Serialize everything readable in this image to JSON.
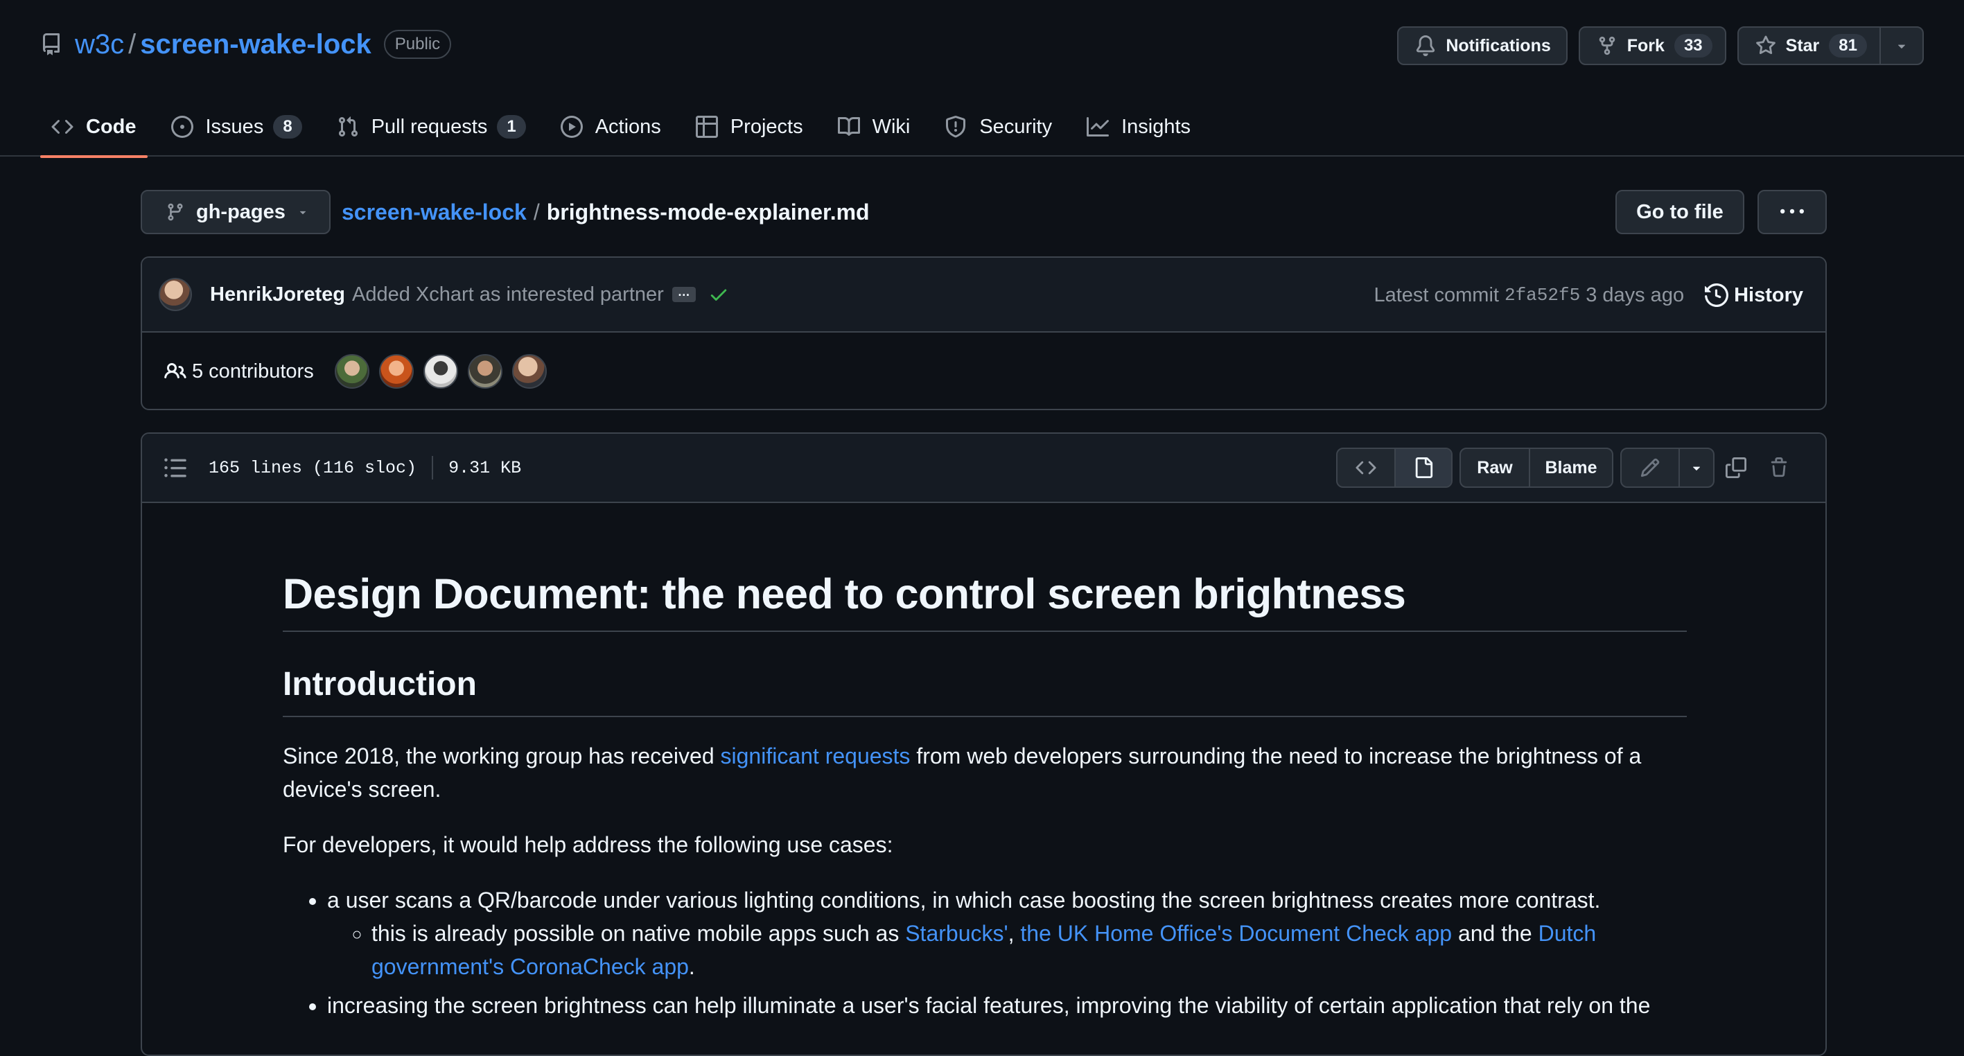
{
  "repo": {
    "owner": "w3c",
    "separator": "/",
    "name": "screen-wake-lock",
    "visibility": "Public"
  },
  "header_actions": {
    "notifications_label": "Notifications",
    "fork_label": "Fork",
    "fork_count": "33",
    "star_label": "Star",
    "star_count": "81"
  },
  "tabs": [
    {
      "label": "Code",
      "icon": "code-icon",
      "selected": true
    },
    {
      "label": "Issues",
      "icon": "issue-icon",
      "count": "8"
    },
    {
      "label": "Pull requests",
      "icon": "pull-request-icon",
      "count": "1"
    },
    {
      "label": "Actions",
      "icon": "play-icon"
    },
    {
      "label": "Projects",
      "icon": "table-icon"
    },
    {
      "label": "Wiki",
      "icon": "book-icon"
    },
    {
      "label": "Security",
      "icon": "shield-icon"
    },
    {
      "label": "Insights",
      "icon": "graph-icon"
    }
  ],
  "breadcrumb": {
    "branch": "gh-pages",
    "repo": "screen-wake-lock",
    "separator": "/",
    "file": "brightness-mode-explainer.md",
    "go_to_file": "Go to file"
  },
  "commit": {
    "author": "HenrikJoreteg",
    "message": "Added Xchart as interested partner",
    "ellipsis": "…",
    "latest_label": "Latest commit",
    "sha": "2fa52f5",
    "age": "3 days ago",
    "history_label": "History",
    "contributors_label": "5 contributors",
    "contributor_avatars": 5
  },
  "file": {
    "lines": "165 lines (116 sloc)",
    "size": "9.31 KB",
    "raw_label": "Raw",
    "blame_label": "Blame"
  },
  "content": {
    "h1": "Design Document: the need to control screen brightness",
    "h2": "Introduction",
    "p1_before": "Since 2018, the working group has received ",
    "p1_link": "significant requests",
    "p1_after": " from web developers surrounding the need to increase the brightness of a device's screen.",
    "p2": "For developers, it would help address the following use cases:",
    "li1": "a user scans a QR/barcode under various lighting conditions, in which case boosting the screen brightness creates more contrast.",
    "li1_sub_before": "this is already possible on native mobile apps such as ",
    "li1_sub_link1": "Starbucks'",
    "li1_sub_comma": ", ",
    "li1_sub_link2": "the UK Home Office's Document Check app",
    "li1_sub_mid": " and the ",
    "li1_sub_link3": "Dutch government's CoronaCheck app",
    "li1_sub_end": ".",
    "li2": "increasing the screen brightness can help illuminate a user's facial features, improving the viability of certain application that rely on the"
  },
  "colors": {
    "background": "#0d1117",
    "link": "#4493f8",
    "tab_underline": "#f78166",
    "success": "#3fb950"
  }
}
